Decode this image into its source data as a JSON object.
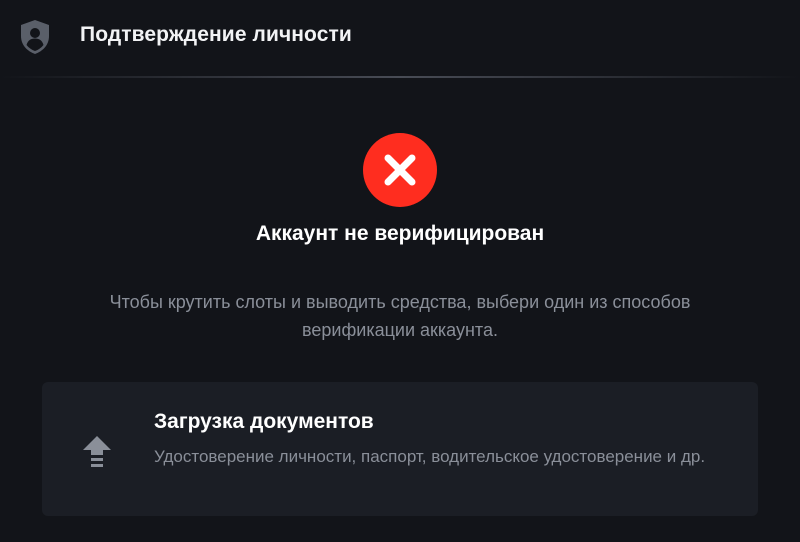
{
  "header": {
    "title": "Подтверждение личности",
    "icon": "shield-user-icon"
  },
  "status": {
    "icon": "error-x-icon",
    "icon_color": "#ff2d1f",
    "title": "Аккаунт не верифицирован",
    "description": "Чтобы крутить слоты и выводить средства, выбери один из способов верификации аккаунта."
  },
  "options": [
    {
      "icon": "upload-icon",
      "title": "Загрузка документов",
      "description": "Удостоверение личности, паспорт, водительское удостоверение и др."
    }
  ],
  "colors": {
    "background": "#121419",
    "card": "#1b1e25",
    "muted_text": "#8a8f99",
    "error": "#ff2d1f"
  }
}
